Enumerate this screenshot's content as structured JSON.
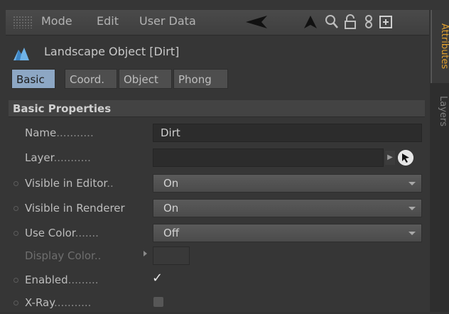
{
  "menubar": {
    "items": [
      "Mode",
      "Edit",
      "User Data"
    ],
    "icons": [
      "back-arrow-icon",
      "up-arrow-icon",
      "search-icon",
      "lock-icon",
      "link-icon",
      "new-panel-icon"
    ]
  },
  "side_tabs": {
    "attributes": "Attributes",
    "layers": "Layers"
  },
  "object": {
    "title": "Landscape Object [Dirt]",
    "icon": "landscape-icon"
  },
  "tabs": [
    "Basic",
    "Coord.",
    "Object",
    "Phong"
  ],
  "section": {
    "title": "Basic Properties"
  },
  "fields": {
    "name": {
      "label": "Name",
      "dots": "...........",
      "value": "Dirt"
    },
    "layer": {
      "label": "Layer",
      "dots": "...........",
      "value": ""
    },
    "visible_editor": {
      "label": "Visible in Editor",
      "dots": "..",
      "value": "On"
    },
    "visible_renderer": {
      "label": "Visible in Renderer",
      "value": "On"
    },
    "use_color": {
      "label": "Use Color",
      "dots": ".......",
      "value": "Off"
    },
    "display_color": {
      "label": "Display Color",
      "dots": "..",
      "color": "#393939"
    },
    "enabled": {
      "label": "Enabled",
      "dots": ".........",
      "checked": true,
      "mark": "✓"
    },
    "xray": {
      "label": "X-Ray",
      "dots": "...........",
      "checked": false
    }
  },
  "colors": {
    "accent_tab": "#8da7c4",
    "side_tab_active": "#e0a030"
  }
}
